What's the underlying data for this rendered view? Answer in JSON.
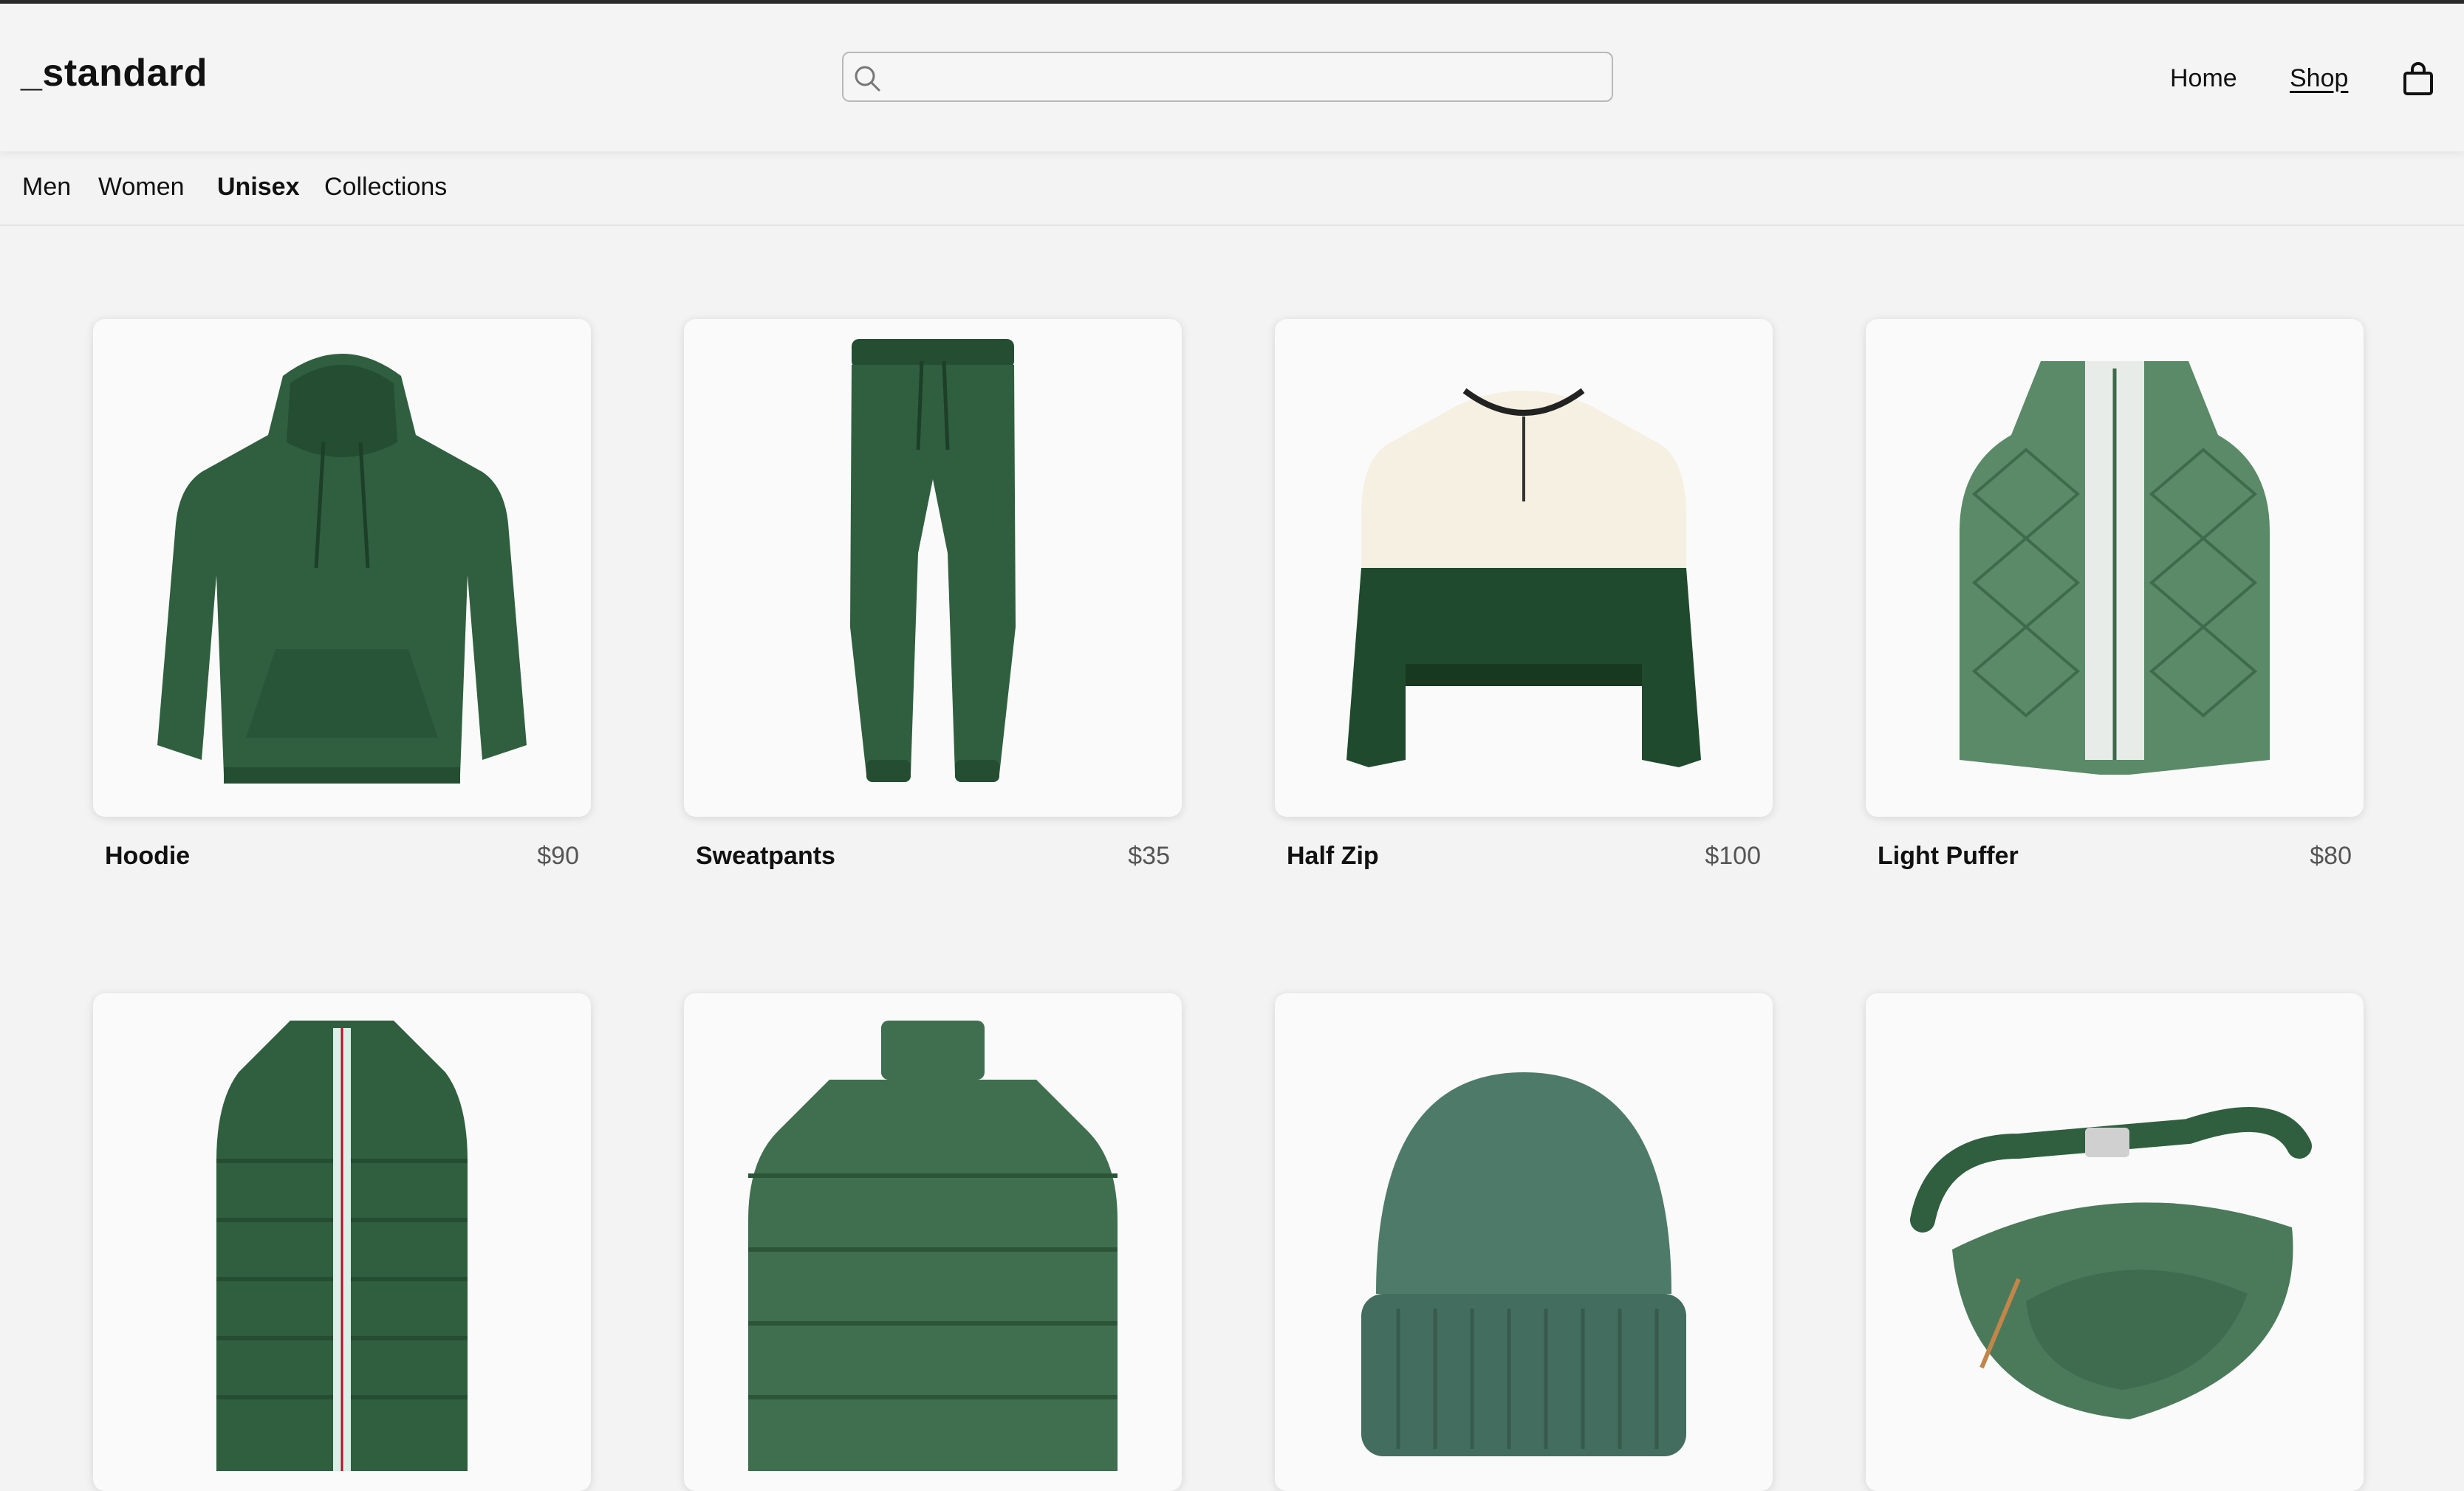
{
  "brand": "_standard",
  "search": {
    "placeholder": ""
  },
  "nav": {
    "home": "Home",
    "shop": "Shop"
  },
  "categories": [
    {
      "label": "Men",
      "active": false
    },
    {
      "label": "Women",
      "active": false
    },
    {
      "label": "Unisex",
      "active": true
    },
    {
      "label": "Collections",
      "active": false
    }
  ],
  "products": [
    {
      "name": "Hoodie",
      "price": "$90",
      "icon": "hoodie-icon"
    },
    {
      "name": "Sweatpants",
      "price": "$35",
      "icon": "sweatpants-icon"
    },
    {
      "name": "Half Zip",
      "price": "$100",
      "icon": "half-zip-icon"
    },
    {
      "name": "Light Puffer",
      "price": "$80",
      "icon": "quilted-vest-icon"
    },
    {
      "name": "",
      "price": "",
      "icon": "puffer-vest-icon"
    },
    {
      "name": "",
      "price": "",
      "icon": "puffer-jacket-icon"
    },
    {
      "name": "",
      "price": "",
      "icon": "beanie-icon"
    },
    {
      "name": "",
      "price": "",
      "icon": "belt-bag-icon"
    }
  ],
  "colors": {
    "green": "#2f5f3f",
    "darkGreen": "#1f4a2d",
    "cream": "#f5f0e1",
    "sage": "#5a8a68"
  }
}
